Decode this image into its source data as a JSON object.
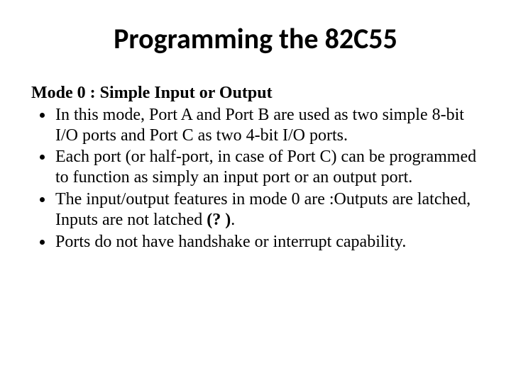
{
  "title": "Programming the 82C55",
  "subheading": "Mode 0 : Simple Input or Output",
  "bullets": [
    "In this mode, Port A and Port B are used as two simple 8-bit I/O ports and Port C as two 4-bit I/O ports.",
    "Each port (or half-port, in case of Port C) can be programmed to function as simply an input port or an output port.",
    "The input/output features in mode 0 are :Outputs are latched, Inputs are not latched ",
    "Ports do not have handshake or interrupt capability."
  ],
  "emph_after_b2": "(? )",
  "period_after_emph": "."
}
